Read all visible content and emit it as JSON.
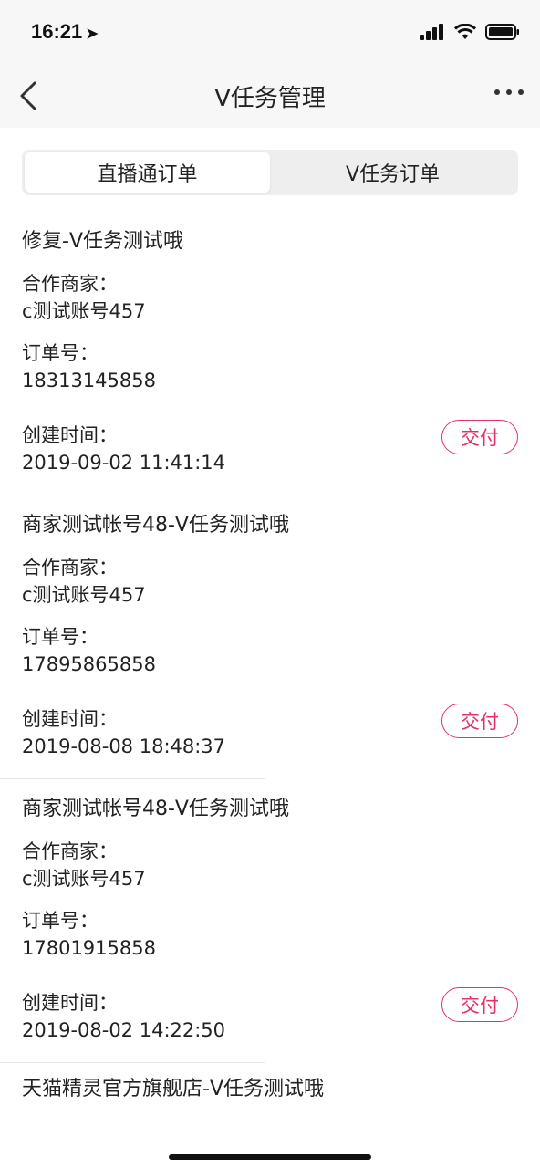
{
  "status": {
    "time": "16:21"
  },
  "nav": {
    "title": "V任务管理"
  },
  "tabs": [
    {
      "label": "直播通订单",
      "active": true
    },
    {
      "label": "V任务订单",
      "active": false
    }
  ],
  "labels": {
    "partner": "合作商家：",
    "order_no": "订单号：",
    "created": "创建时间：",
    "deliver": "交付"
  },
  "orders": [
    {
      "title": "修复-V任务测试哦",
      "partner": "c测试账号457",
      "order_no": "18313145858",
      "created": "2019-09-02 11:41:14"
    },
    {
      "title": "商家测试帐号48-V任务测试哦",
      "partner": "c测试账号457",
      "order_no": "17895865858",
      "created": "2019-08-08 18:48:37"
    },
    {
      "title": "商家测试帐号48-V任务测试哦",
      "partner": "c测试账号457",
      "order_no": "17801915858",
      "created": "2019-08-02 14:22:50"
    },
    {
      "title": "天猫精灵官方旗舰店-V任务测试哦"
    }
  ],
  "colors": {
    "accent": "#e0336a",
    "header_bg": "#f7f7f7",
    "segment_bg": "#eeeeee"
  }
}
